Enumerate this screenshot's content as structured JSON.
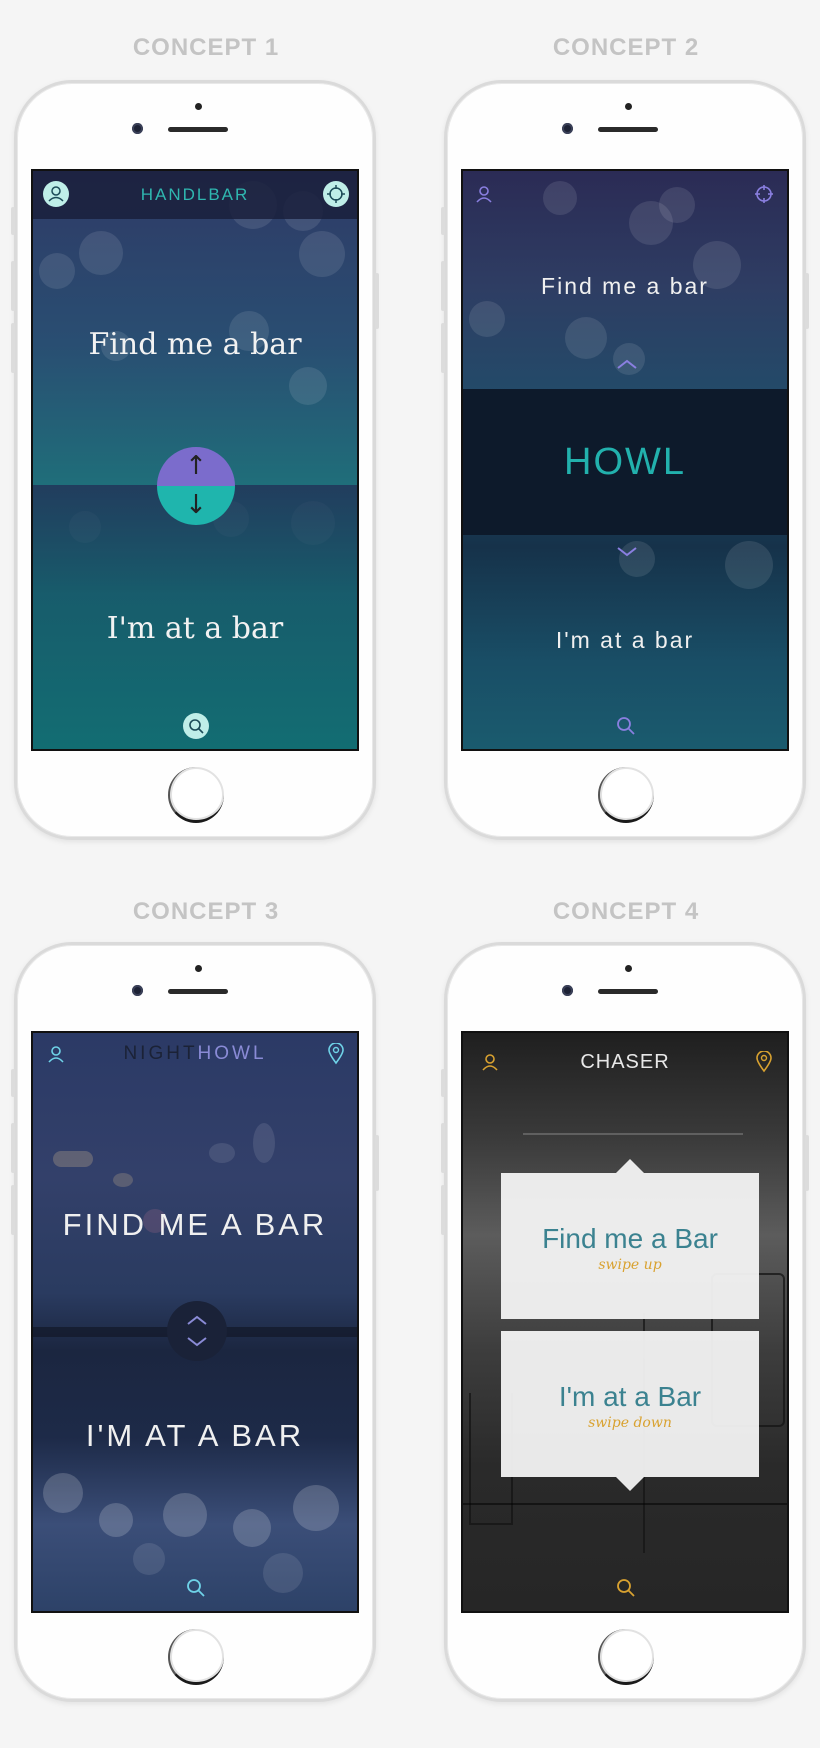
{
  "concepts": [
    {
      "title": "CONCEPT 1",
      "brand": "HANDLBAR",
      "top_text": "Find me a bar",
      "bottom_text": "I'm at a bar",
      "icons": [
        "user-icon",
        "settings-icon",
        "search-icon",
        "up-arrow-icon",
        "down-arrow-icon"
      ],
      "colors": {
        "accent": "#2fb7b0",
        "toggle_top": "#7b6ccc",
        "toggle_bottom": "#1fb5ad"
      }
    },
    {
      "title": "CONCEPT 2",
      "brand": "HOWL",
      "top_text": "Find me a bar",
      "bottom_text": "I'm at a bar",
      "icons": [
        "user-icon",
        "crosshair-icon",
        "chevron-up-icon",
        "chevron-down-icon",
        "search-icon"
      ],
      "colors": {
        "accent": "#22b1ad",
        "icon": "#8a7fe0"
      }
    },
    {
      "title": "CONCEPT 3",
      "brand_part1": "NIGHT",
      "brand_part2": "HOWL",
      "top_text": "FIND ME A BAR",
      "bottom_text": "I'M AT A BAR",
      "icons": [
        "user-icon",
        "location-pin-icon",
        "chevron-up-icon",
        "chevron-down-icon",
        "search-icon"
      ],
      "colors": {
        "accent": "#6fd3e8",
        "brand_b": "#8a8bd6"
      }
    },
    {
      "title": "CONCEPT 4",
      "brand": "CHASER",
      "top_text": "Find me a Bar",
      "top_hint": "swipe up",
      "bottom_text": "I'm at a Bar",
      "bottom_hint": "swipe down",
      "icons": [
        "user-icon",
        "location-pin-icon",
        "search-icon"
      ],
      "colors": {
        "accent": "#d9a230",
        "text": "#3b8290"
      }
    }
  ]
}
